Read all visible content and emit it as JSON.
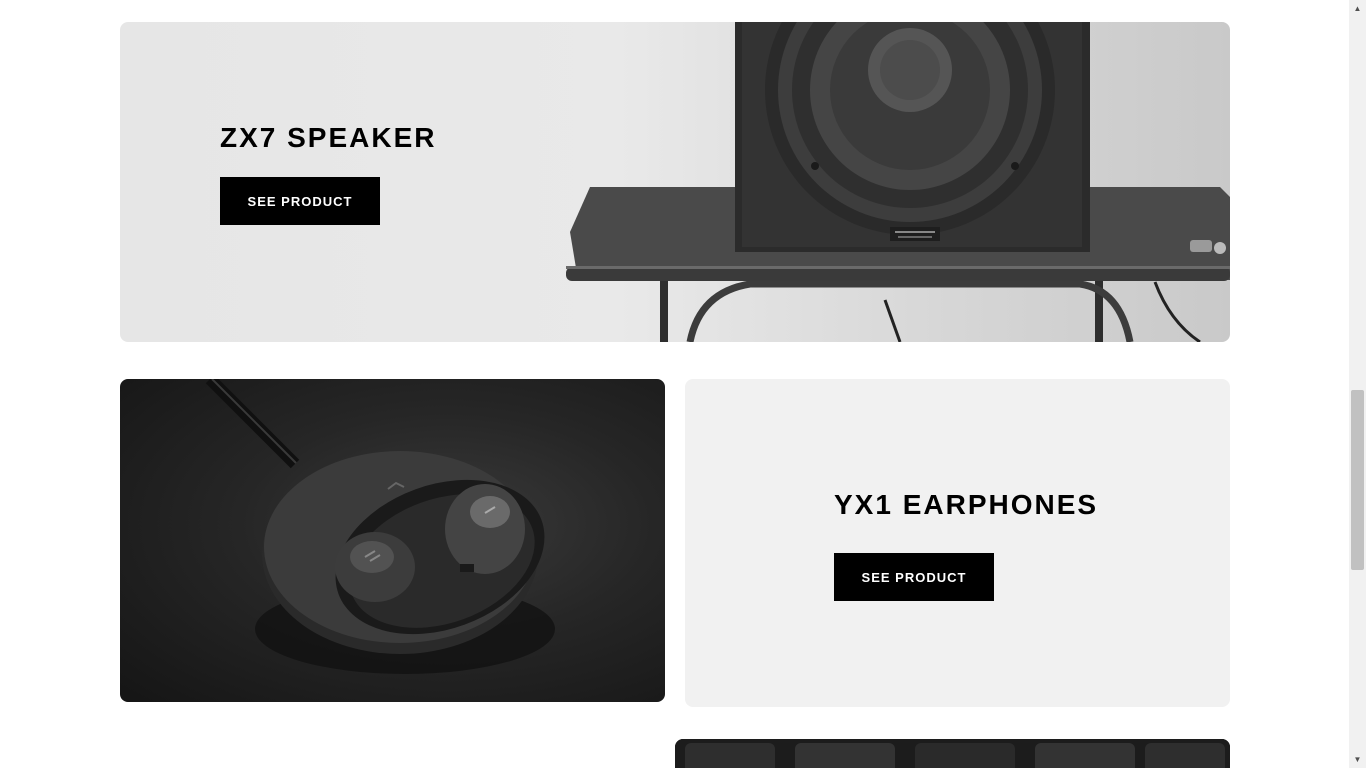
{
  "products": {
    "zx7": {
      "title": "ZX7 SPEAKER",
      "button_label": "SEE PRODUCT"
    },
    "yx1": {
      "title": "YX1 EARPHONES",
      "button_label": "SEE PRODUCT"
    }
  },
  "scrollbar": {
    "up_glyph": "▲",
    "down_glyph": "▼"
  },
  "colors": {
    "button_bg": "#000000",
    "button_text": "#ffffff",
    "card_bg": "#f1f1f1"
  }
}
